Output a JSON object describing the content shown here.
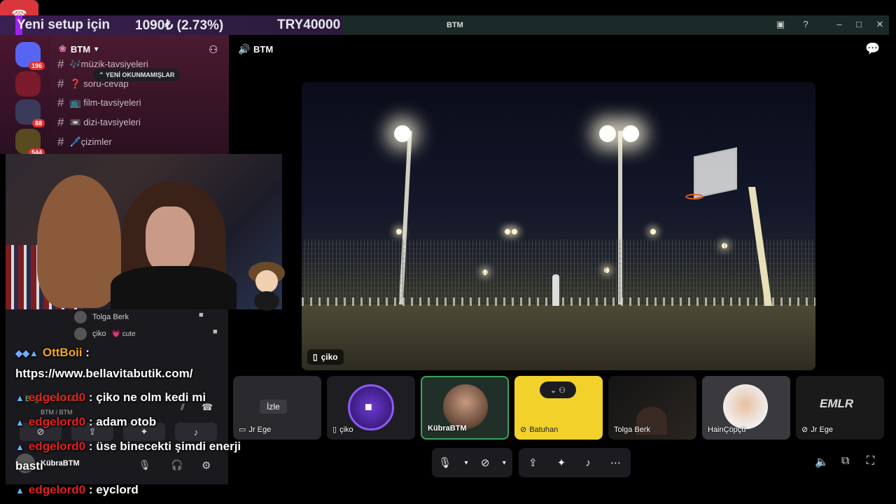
{
  "ticker": {
    "headline": "Yeni setup için",
    "change": "1090₺ (2.73%)",
    "goal": "TRY40000"
  },
  "window": {
    "title": "BTM"
  },
  "server_rail": {
    "badges": [
      "196",
      "88",
      "544"
    ]
  },
  "channel_list": {
    "server_name": "BTM",
    "new_unreads_banner": "YENİ OKUNMAMIŞLAR",
    "channels": [
      {
        "label": "🎶müzik-tavsiyeleri"
      },
      {
        "label": "❓ soru-cevap"
      },
      {
        "label": "📺 film-tavsiyeleri"
      },
      {
        "label": "📼 dizi-tavsiyeleri"
      },
      {
        "label": "🖊️çizimler"
      }
    ]
  },
  "voice_panel": {
    "users": [
      {
        "name": "Tolga Berk"
      },
      {
        "name": "çiko",
        "tag": "💗 cute"
      }
    ],
    "status_line": "Bağlantı Kuruldu",
    "status_sub": "BTM / BTM",
    "self_name": "KübraBTM"
  },
  "chat": [
    {
      "user": "OttBoii",
      "text": ":"
    },
    {
      "user": "",
      "text": "https://www.bellavitabutik.com/"
    },
    {
      "user": "edgelord0",
      "text": ": çiko ne olm kedi mi"
    },
    {
      "user": "edgelord0",
      "text": ": adam otob"
    },
    {
      "user": "edgelord0",
      "text": ": üse binecekti şimdi enerji"
    },
    {
      "user": "",
      "text": "bastı"
    },
    {
      "user": "edgelord0",
      "text": ": eyclord"
    }
  ],
  "main": {
    "channel_title": "BTM",
    "focused_user": "çiko"
  },
  "tiles": [
    {
      "label": "Jr Ege",
      "center": "İzle"
    },
    {
      "label": "çiko"
    },
    {
      "label": "KübraBTM"
    },
    {
      "label": "Batuhan"
    },
    {
      "label": "Tolga Berk"
    },
    {
      "label": "HainÇöpçü"
    },
    {
      "label": "Jr Ege",
      "center": "EMLR"
    }
  ],
  "colors": {
    "accent_purple": "#a020f0",
    "hangup_red": "#da373c",
    "chat_name_red": "#e02020",
    "chat_name_gold": "#f5a623",
    "batuhan_tile": "#f2d12b"
  }
}
